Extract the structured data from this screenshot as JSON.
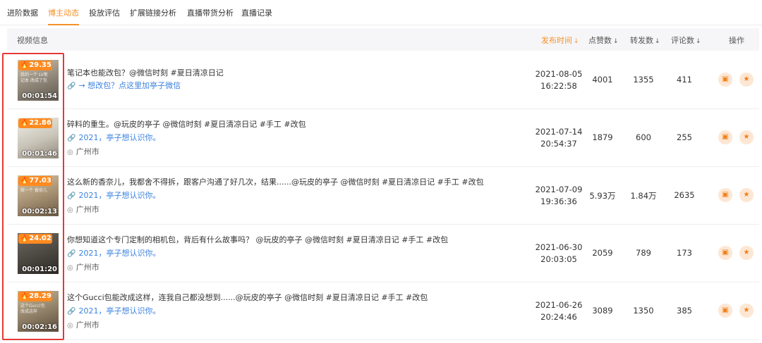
{
  "tabs": [
    "进阶数据",
    "博主动态",
    "投放评估",
    "扩展链接分析",
    "直播带货分析",
    "直播记录"
  ],
  "active_tab": "博主动态",
  "accent_color": "#f5922a",
  "highlight_color": "#e53935",
  "columns": {
    "info": "视频信息",
    "publish_time": "发布时间",
    "likes": "点赞数",
    "shares": "转发数",
    "comments": "评论数",
    "action": "操作",
    "sort_arrow": "↓"
  },
  "videos": [
    {
      "heat": "29.35",
      "duration": "00:01:54",
      "title": "笔记本也能改包？@微信时刻 #夏日清凉日记",
      "link": "→ 想改包？点这里加亭子微信",
      "location": "",
      "date": "2021-08-05",
      "time": "16:22:58",
      "likes": "4001",
      "shares": "1355",
      "comments": "411"
    },
    {
      "heat": "22.86",
      "duration": "00:01:46",
      "title": "碎料的重生。@玩皮的亭子 @微信时刻 #夏日清凉日记 #手工 #改包",
      "link": "2021，亭子想认识你。",
      "location": "广州市",
      "date": "2021-07-14",
      "time": "20:54:37",
      "likes": "1879",
      "shares": "600",
      "comments": "255"
    },
    {
      "heat": "77.03",
      "duration": "00:02:13",
      "title": "这么新的香奈儿，我都舍不得拆，跟客户沟通了好几次，结果......@玩皮的亭子 @微信时刻 #夏日清凉日记 #手工 #改包",
      "link": "2021，亭子想认识你。",
      "location": "广州市",
      "date": "2021-07-09",
      "time": "19:36:36",
      "likes": "5.93万",
      "shares": "1.84万",
      "comments": "2635"
    },
    {
      "heat": "24.02",
      "duration": "00:01:20",
      "title": "你想知道这个专门定制的相机包，背后有什么故事吗？ @玩皮的亭子 @微信时刻 #夏日清凉日记 #手工 #改包",
      "link": "2021，亭子想认识你。",
      "location": "广州市",
      "date": "2021-06-30",
      "time": "20:03:05",
      "likes": "2059",
      "shares": "789",
      "comments": "173"
    },
    {
      "heat": "28.29",
      "duration": "00:02:16",
      "title": "这个Gucci包能改成这样，连我自己都没想到......@玩皮的亭子 @微信时刻 #夏日清凉日记 #手工 #改包",
      "link": "2021，亭子想认识你。",
      "location": "广州市",
      "date": "2021-06-26",
      "time": "20:24:46",
      "likes": "3089",
      "shares": "1350",
      "comments": "385"
    }
  ],
  "thumb_captions": [
    "我的一个 LV笔记本 改成了包",
    "",
    "就一个 香奈儿",
    "",
    "这个Gucci包 改成这样"
  ]
}
